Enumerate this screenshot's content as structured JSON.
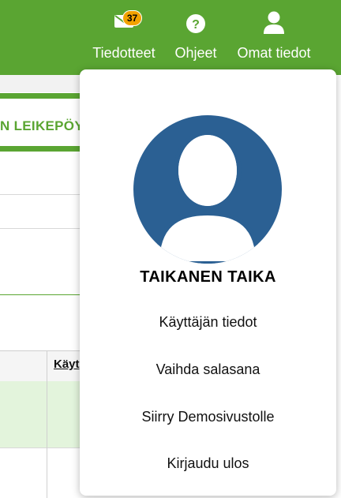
{
  "header": {
    "messages": {
      "label": "Tiedotteet",
      "badge": "37",
      "icon": "envelope-icon"
    },
    "help": {
      "label": "Ohjeet",
      "icon": "question-circle-icon"
    },
    "account": {
      "label": "Omat tiedot",
      "icon": "user-icon"
    }
  },
  "background": {
    "clipboard_tab": "N LEIKEPÖY",
    "table_header_link": "Käyt"
  },
  "user_menu": {
    "name": "TAIKANEN TAIKA",
    "items": [
      {
        "label": "Käyttäjän tiedot"
      },
      {
        "label": "Vaihda salasana"
      },
      {
        "label": "Siirry Demosivustolle"
      },
      {
        "label": "Kirjaudu ulos"
      }
    ]
  },
  "colors": {
    "brand_green": "#5aa532",
    "avatar_blue": "#2b6093",
    "badge_orange": "#f2a200",
    "row_highlight": "#e3f4dc"
  }
}
